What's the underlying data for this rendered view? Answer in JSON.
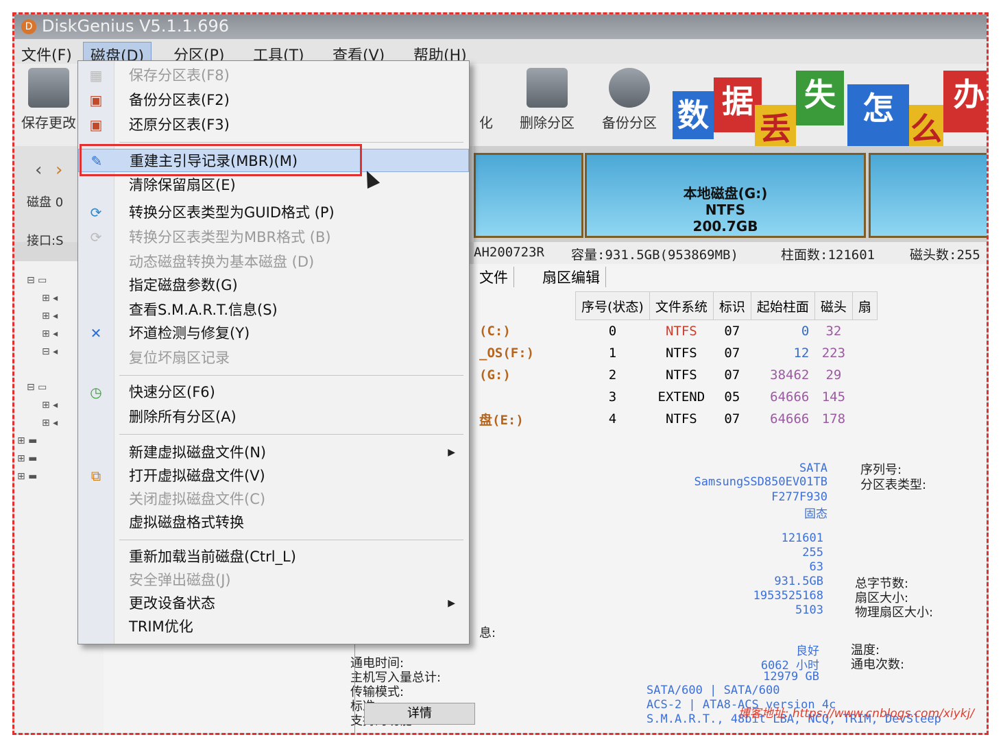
{
  "window": {
    "title": "DiskGenius V5.1.1.696"
  },
  "menubar": [
    "文件(F)",
    "磁盘(D)",
    "分区(P)",
    "工具(T)",
    "查看(V)",
    "帮助(H)"
  ],
  "toolbar": {
    "save": "保存更改",
    "partial_label": "化",
    "delete": "删除分区",
    "backup": "备份分区"
  },
  "banner": [
    "数",
    "据",
    "丢",
    "失",
    "怎",
    "么",
    "办"
  ],
  "nav": {
    "disk_label": "磁盘 0",
    "iface_label": "接口:S"
  },
  "disk_segments": [
    {
      "name": "本地磁盘(G:)",
      "fs": "NTFS",
      "size": "200.7GB"
    }
  ],
  "disk_info": {
    "model_suffix": "AH200723R",
    "capacity": "容量:931.5GB(953869MB)",
    "cylinders": "柱面数:121601",
    "heads": "磁头数:255"
  },
  "tabs": [
    "文件",
    "扇区编辑"
  ],
  "partition_table": {
    "headers": [
      "序号(状态)",
      "文件系统",
      "标识",
      "起始柱面",
      "磁头",
      "扇"
    ],
    "rows": [
      {
        "name": "(C:)",
        "idx": "0",
        "fs": "NTFS",
        "id": "07",
        "cyl": "0",
        "head": "32"
      },
      {
        "name": "_OS(F:)",
        "idx": "1",
        "fs": "NTFS",
        "id": "07",
        "cyl": "12",
        "head": "223"
      },
      {
        "name": "(G:)",
        "idx": "2",
        "fs": "NTFS",
        "id": "07",
        "cyl": "38462",
        "head": "29"
      },
      {
        "name": "",
        "idx": "3",
        "fs": "EXTEND",
        "id": "05",
        "cyl": "64666",
        "head": "145"
      },
      {
        "name": "盘(E:)",
        "idx": "4",
        "fs": "NTFS",
        "id": "07",
        "cyl": "64666",
        "head": "178"
      }
    ]
  },
  "details": {
    "values1": [
      "SATA",
      "SamsungSSD850EV01TB",
      "F277F930",
      "固态"
    ],
    "labels_right1": [
      "序列号:",
      "分区表类型:"
    ],
    "values2": [
      "121601",
      "255",
      "63",
      "931.5GB",
      "1953525168",
      "5103"
    ],
    "labels_right2": [
      "总字节数:",
      "扇区大小:",
      "物理扇区大小:"
    ],
    "values3": [
      "良好",
      "6062 小时",
      "12979 GB"
    ],
    "labels_right3": [
      "温度:",
      "通电次数:"
    ],
    "labels_left": [
      "通电时间:",
      "主机写入量总计:",
      "传输模式:",
      "标准:",
      "支持的功能:"
    ],
    "transfer": "SATA/600 | SATA/600",
    "standard": "ACS-2 | ATA8-ACS version 4c",
    "features": "S.M.A.R.T., 48bit LBA, NCQ, TRIM, DevSleep",
    "details_button": "详情",
    "partial_label": "息:"
  },
  "menu": {
    "items": [
      {
        "label": "保存分区表(F8)",
        "enabled": false,
        "icon": "save-icon"
      },
      {
        "label": "备份分区表(F2)",
        "enabled": true,
        "icon": "backup-icon"
      },
      {
        "label": "还原分区表(F3)",
        "enabled": true,
        "icon": "restore-icon"
      },
      {
        "label": "重建主引导记录(MBR)(M)",
        "enabled": true,
        "icon": "mbr-icon",
        "highlight": true
      },
      {
        "label": "清除保留扇区(E)",
        "enabled": true
      },
      {
        "label": "转换分区表类型为GUID格式 (P)",
        "enabled": true,
        "icon": "convert-icon"
      },
      {
        "label": "转换分区表类型为MBR格式 (B)",
        "enabled": false,
        "icon": "convert-icon"
      },
      {
        "label": "动态磁盘转换为基本磁盘 (D)",
        "enabled": false
      },
      {
        "label": "指定磁盘参数(G)",
        "enabled": true
      },
      {
        "label": "查看S.M.A.R.T.信息(S)",
        "enabled": true
      },
      {
        "label": "坏道检测与修复(Y)",
        "enabled": true,
        "icon": "tools-icon"
      },
      {
        "label": "复位坏扇区记录",
        "enabled": false
      },
      {
        "label": "快速分区(F6)",
        "enabled": true,
        "icon": "clock-icon"
      },
      {
        "label": "删除所有分区(A)",
        "enabled": true
      },
      {
        "label": "新建虚拟磁盘文件(N)",
        "enabled": true,
        "submenu": true
      },
      {
        "label": "打开虚拟磁盘文件(V)",
        "enabled": true,
        "icon": "vdisk-icon"
      },
      {
        "label": "关闭虚拟磁盘文件(C)",
        "enabled": false
      },
      {
        "label": "虚拟磁盘格式转换",
        "enabled": true
      },
      {
        "label": "重新加载当前磁盘(Ctrl_L)",
        "enabled": true
      },
      {
        "label": "安全弹出磁盘(J)",
        "enabled": false
      },
      {
        "label": "更改设备状态",
        "enabled": true,
        "submenu": true
      },
      {
        "label": "TRIM优化",
        "enabled": true
      }
    ]
  },
  "watermark": "博客地址: https://www.cnblogs.com/xiykj/",
  "colors": {
    "accent_red": "#e03030",
    "partition_blue": "#4ca8d6",
    "value_blue": "#3a6cc6"
  }
}
